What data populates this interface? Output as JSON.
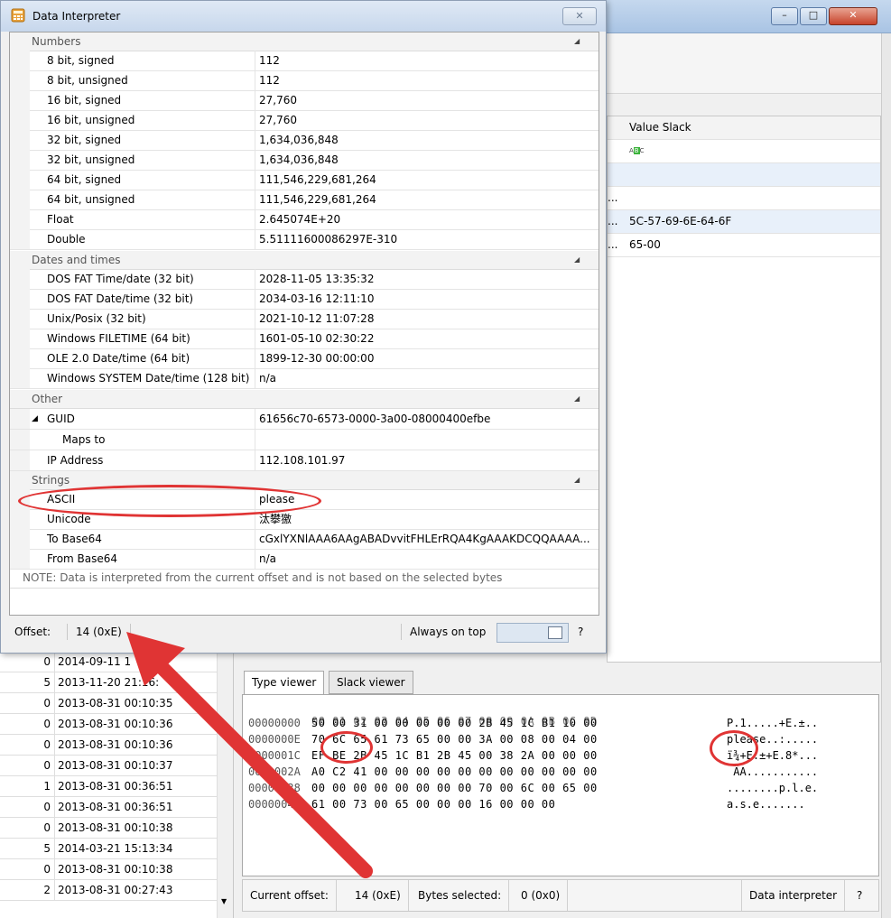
{
  "dialog": {
    "title": "Data Interpreter",
    "close_label": "✕",
    "groups": {
      "numbers": {
        "label": "Numbers",
        "rows": [
          {
            "key": "8 bit, signed",
            "value": "112"
          },
          {
            "key": "8 bit, unsigned",
            "value": "112"
          },
          {
            "key": "16 bit, signed",
            "value": "27,760"
          },
          {
            "key": "16 bit, unsigned",
            "value": "27,760"
          },
          {
            "key": "32 bit, signed",
            "value": "1,634,036,848"
          },
          {
            "key": "32 bit, unsigned",
            "value": "1,634,036,848"
          },
          {
            "key": "64 bit, signed",
            "value": "111,546,229,681,264"
          },
          {
            "key": "64 bit, unsigned",
            "value": "111,546,229,681,264"
          },
          {
            "key": "Float",
            "value": "2.645074E+20"
          },
          {
            "key": "Double",
            "value": "5.51111600086297E-310"
          }
        ]
      },
      "dates": {
        "label": "Dates and times",
        "rows": [
          {
            "key": "DOS FAT Time/date (32 bit)",
            "value": "2028-11-05 13:35:32"
          },
          {
            "key": "DOS FAT Date/time (32 bit)",
            "value": "2034-03-16 12:11:10"
          },
          {
            "key": "Unix/Posix (32 bit)",
            "value": "2021-10-12 11:07:28"
          },
          {
            "key": "Windows FILETIME (64 bit)",
            "value": "1601-05-10 02:30:22"
          },
          {
            "key": "OLE 2.0 Date/time (64 bit)",
            "value": "1899-12-30 00:00:00"
          },
          {
            "key": "Windows SYSTEM Date/time (128 bit)",
            "value": "n/a"
          }
        ]
      },
      "other": {
        "label": "Other",
        "guid_key": "GUID",
        "guid_value": "61656c70-6573-0000-3a00-08000400efbe",
        "maps_to_key": "Maps to",
        "maps_to_value": "",
        "ip_key": "IP Address",
        "ip_value": "112.108.101.97"
      },
      "strings": {
        "label": "Strings",
        "rows": [
          {
            "key": "ASCII",
            "value": "please"
          },
          {
            "key": "Unicode",
            "value": "汰攀獥"
          },
          {
            "key": "To Base64",
            "value": "cGxlYXNlAAA6AAgABADvvitFHLErRQA4KgAAAKDCQQAAAA..."
          },
          {
            "key": "From Base64",
            "value": "n/a"
          }
        ]
      }
    },
    "note": "NOTE: Data is interpreted from the current offset and is not based on the selected bytes",
    "status": {
      "offset_label": "Offset:",
      "offset_value": "14 (0xE)",
      "always_on_top_label": "Always on top",
      "help_label": "?"
    }
  },
  "main_window": {
    "buttons": {
      "minimize": "–",
      "maximize": "□",
      "close": "✕"
    },
    "table": {
      "col_header": "Value Slack",
      "rows": [
        "",
        "...",
        "5C-57-69-6E-64-6F",
        "65-00"
      ],
      "ellipsis": "..."
    },
    "file_list": [
      {
        "num": "0",
        "date": "2014-09-11 1"
      },
      {
        "num": "5",
        "date": "2013-11-20 21:16:"
      },
      {
        "num": "0",
        "date": "2013-08-31 00:10:35"
      },
      {
        "num": "0",
        "date": "2013-08-31 00:10:36"
      },
      {
        "num": "0",
        "date": "2013-08-31 00:10:36"
      },
      {
        "num": "0",
        "date": "2013-08-31 00:10:37"
      },
      {
        "num": "1",
        "date": "2013-08-31 00:36:51"
      },
      {
        "num": "0",
        "date": "2013-08-31 00:36:51"
      },
      {
        "num": "0",
        "date": "2013-08-31 00:10:38"
      },
      {
        "num": "5",
        "date": "2014-03-21 15:13:34"
      },
      {
        "num": "0",
        "date": "2013-08-31 00:10:38"
      },
      {
        "num": "2",
        "date": "2013-08-31 00:27:43"
      }
    ],
    "tabs": {
      "type_viewer": "Type viewer",
      "slack_viewer": "Slack viewer"
    },
    "hex": {
      "header": "00 01 02 03 04 05 06 07 08 09 0A 0B 0C 0D",
      "lines": [
        {
          "offset": "00000000",
          "bytes": "50 00 31 00 00 00 00 00 2B 45 1C B1 10 00",
          "ascii": "P.1.....+E.±.."
        },
        {
          "offset": "0000000E",
          "bytes": "70 6C 65 61 73 65 00 00 3A 00 08 00 04 00",
          "ascii": "please..:....."
        },
        {
          "offset": "0000001C",
          "bytes": "EF BE 2B 45 1C B1 2B 45 00 38 2A 00 00 00",
          "ascii": "ï¾+E.±+E.8*..."
        },
        {
          "offset": "0000002A",
          "bytes": "A0 C2 41 00 00 00 00 00 00 00 00 00 00 00",
          "ascii": " ÂA..........."
        },
        {
          "offset": "00000038",
          "bytes": "00 00 00 00 00 00 00 00 70 00 6C 00 65 00",
          "ascii": "........p.l.e."
        },
        {
          "offset": "00000046",
          "bytes": "61 00 73 00 65 00 00 00 16 00 00 00",
          "ascii": "a.s.e......."
        }
      ]
    },
    "statusbar": {
      "current_offset_label": "Current offset:",
      "current_offset_value": "14 (0xE)",
      "bytes_selected_label": "Bytes selected:",
      "bytes_selected_value": "0 (0x0)",
      "data_interpreter_label": "Data interpreter",
      "help_label": "?"
    }
  },
  "colors": {
    "annotation_red": "#e03434",
    "titlebar_blue": "#c7d7ec"
  }
}
